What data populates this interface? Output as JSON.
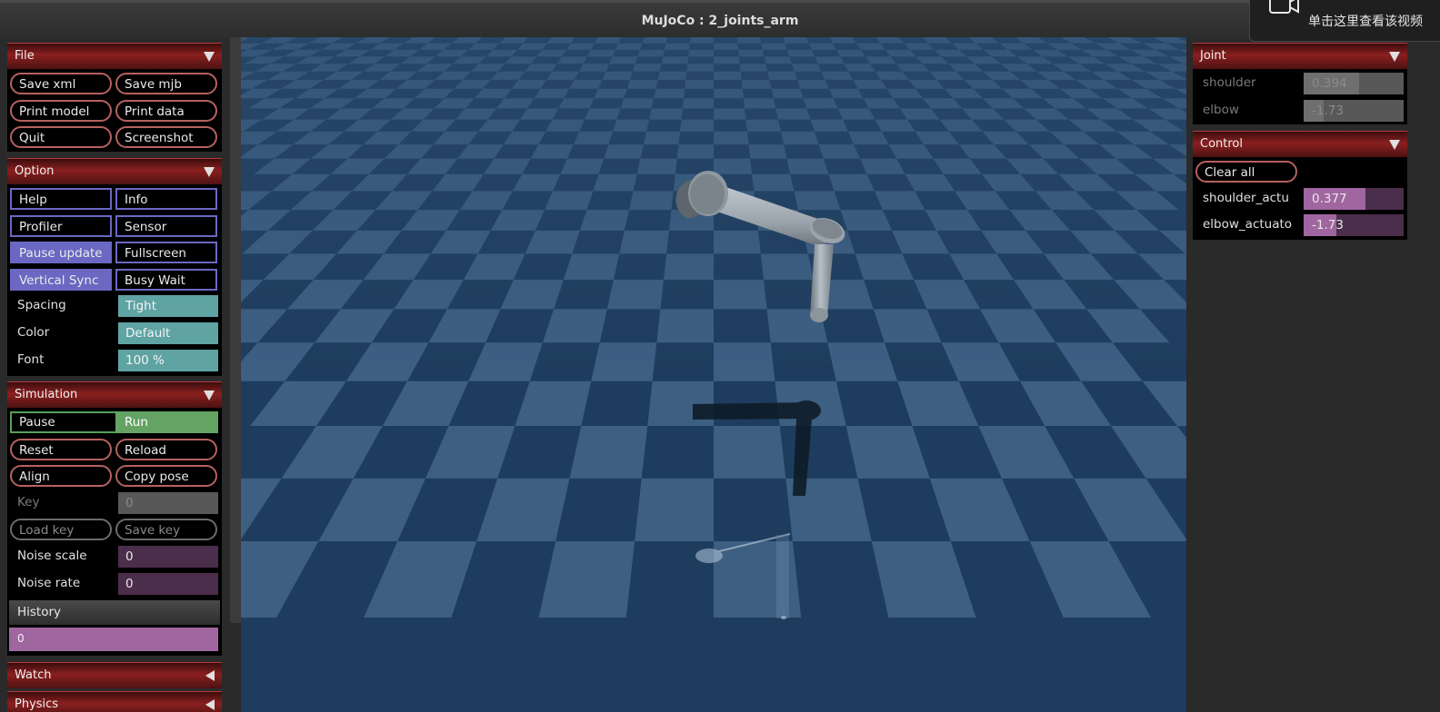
{
  "window": {
    "title": "MuJoCo : 2_joints_arm"
  },
  "notification": {
    "text": "单击这里查看该视频"
  },
  "file": {
    "title": "File",
    "buttons": [
      "Save xml",
      "Save mjb",
      "Print model",
      "Print data",
      "Quit",
      "Screenshot"
    ]
  },
  "option": {
    "title": "Option",
    "toggles": [
      "Help",
      "Info",
      "Profiler",
      "Sensor",
      "Pause update",
      "Fullscreen",
      "Vertical Sync",
      "Busy Wait"
    ],
    "spacing": {
      "label": "Spacing",
      "value": "Tight"
    },
    "color": {
      "label": "Color",
      "value": "Default"
    },
    "font": {
      "label": "Font",
      "value": "100 %"
    }
  },
  "simulation": {
    "title": "Simulation",
    "pause_label": "Pause",
    "run_label": "Run",
    "buttons": [
      "Reset",
      "Reload",
      "Align",
      "Copy pose"
    ],
    "key": {
      "label": "Key",
      "value": "0"
    },
    "load_key_label": "Load key",
    "save_key_label": "Save key",
    "noise_scale": {
      "label": "Noise scale",
      "value": "0"
    },
    "noise_rate": {
      "label": "Noise rate",
      "value": "0"
    },
    "history": {
      "label": "History",
      "value": "0"
    }
  },
  "watch": {
    "title": "Watch"
  },
  "physics": {
    "title": "Physics"
  },
  "joint": {
    "title": "Joint",
    "items": [
      {
        "label": "shoulder",
        "value": "0.394",
        "fill": 0.55
      },
      {
        "label": "elbow",
        "value": "-1.73",
        "fill": 0.2
      }
    ]
  },
  "control": {
    "title": "Control",
    "clear_label": "Clear all",
    "items": [
      {
        "label": "shoulder_actu",
        "value": "0.377",
        "fill": 0.62
      },
      {
        "label": "elbow_actuato",
        "value": "-1.73",
        "fill": 0.33
      }
    ]
  },
  "colors": {
    "header_red": "#8a1f1f",
    "button_border": "#b5625f",
    "toggle_purple": "#6a68c2",
    "field_teal": "#5fa3a3",
    "run_green": "#64a364",
    "slider_pink": "#a066a0",
    "floor_dark": "#1e3d5e",
    "floor_light": "#3d5f82"
  }
}
